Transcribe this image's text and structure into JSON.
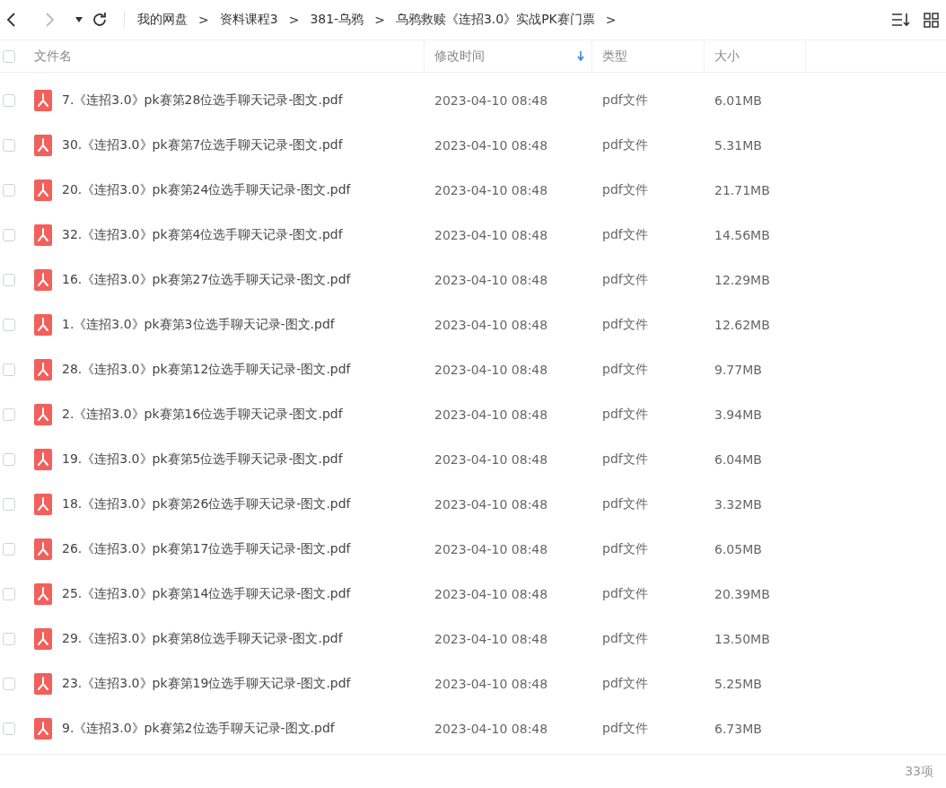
{
  "toolbar": {
    "breadcrumb": [
      "我的网盘",
      "资料课程3",
      "381-乌鸦",
      "乌鸦救赎《连招3.0》实战PK赛门票"
    ],
    "separator": ">"
  },
  "table": {
    "select_all": {
      "checked": false
    },
    "columns": [
      {
        "label": "文件名",
        "sorted": false
      },
      {
        "label": "修改时间",
        "sorted": true
      },
      {
        "label": "类型",
        "sorted": false
      },
      {
        "label": "大小",
        "sorted": false
      }
    ],
    "rows": [
      {
        "name": "7.《连招3.0》pk赛第28位选手聊天记录-图文.pdf",
        "modified": "2023-04-10 08:48",
        "type": "pdf文件",
        "size": "6.01MB",
        "checked": false
      },
      {
        "name": "30.《连招3.0》pk赛第7位选手聊天记录-图文.pdf",
        "modified": "2023-04-10 08:48",
        "type": "pdf文件",
        "size": "5.31MB",
        "checked": false
      },
      {
        "name": "20.《连招3.0》pk赛第24位选手聊天记录-图文.pdf",
        "modified": "2023-04-10 08:48",
        "type": "pdf文件",
        "size": "21.71MB",
        "checked": false
      },
      {
        "name": "32.《连招3.0》pk赛第4位选手聊天记录-图文.pdf",
        "modified": "2023-04-10 08:48",
        "type": "pdf文件",
        "size": "14.56MB",
        "checked": false
      },
      {
        "name": "16.《连招3.0》pk赛第27位选手聊天记录-图文.pdf",
        "modified": "2023-04-10 08:48",
        "type": "pdf文件",
        "size": "12.29MB",
        "checked": false
      },
      {
        "name": "1.《连招3.0》pk赛第3位选手聊天记录-图文.pdf",
        "modified": "2023-04-10 08:48",
        "type": "pdf文件",
        "size": "12.62MB",
        "checked": false
      },
      {
        "name": "28.《连招3.0》pk赛第12位选手聊天记录-图文.pdf",
        "modified": "2023-04-10 08:48",
        "type": "pdf文件",
        "size": "9.77MB",
        "checked": false
      },
      {
        "name": "2.《连招3.0》pk赛第16位选手聊天记录-图文.pdf",
        "modified": "2023-04-10 08:48",
        "type": "pdf文件",
        "size": "3.94MB",
        "checked": false
      },
      {
        "name": "19.《连招3.0》pk赛第5位选手聊天记录-图文.pdf",
        "modified": "2023-04-10 08:48",
        "type": "pdf文件",
        "size": "6.04MB",
        "checked": false
      },
      {
        "name": "18.《连招3.0》pk赛第26位选手聊天记录-图文.pdf",
        "modified": "2023-04-10 08:48",
        "type": "pdf文件",
        "size": "3.32MB",
        "checked": false
      },
      {
        "name": "26.《连招3.0》pk赛第17位选手聊天记录-图文.pdf",
        "modified": "2023-04-10 08:48",
        "type": "pdf文件",
        "size": "6.05MB",
        "checked": false
      },
      {
        "name": "25.《连招3.0》pk赛第14位选手聊天记录-图文.pdf",
        "modified": "2023-04-10 08:48",
        "type": "pdf文件",
        "size": "20.39MB",
        "checked": false
      },
      {
        "name": "29.《连招3.0》pk赛第8位选手聊天记录-图文.pdf",
        "modified": "2023-04-10 08:48",
        "type": "pdf文件",
        "size": "13.50MB",
        "checked": false
      },
      {
        "name": "23.《连招3.0》pk赛第19位选手聊天记录-图文.pdf",
        "modified": "2023-04-10 08:48",
        "type": "pdf文件",
        "size": "5.25MB",
        "checked": false
      },
      {
        "name": "9.《连招3.0》pk赛第2位选手聊天记录-图文.pdf",
        "modified": "2023-04-10 08:48",
        "type": "pdf文件",
        "size": "6.73MB",
        "checked": false
      }
    ]
  },
  "status_bar": {
    "count": "33项"
  }
}
